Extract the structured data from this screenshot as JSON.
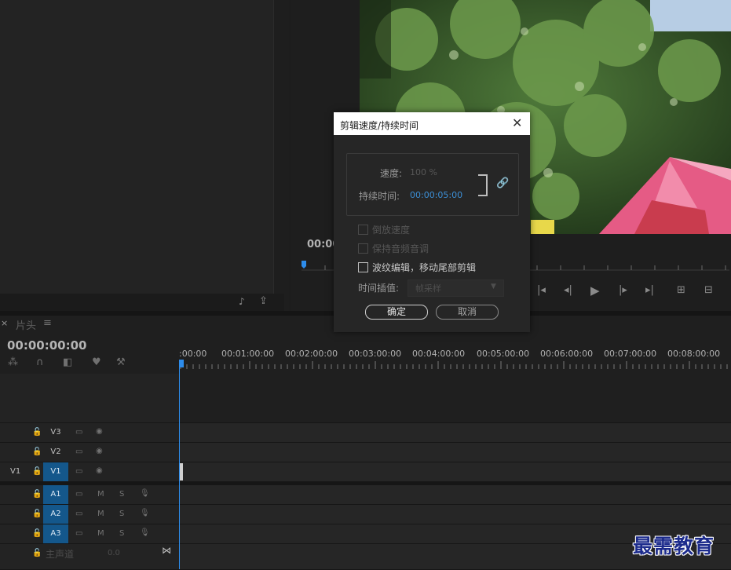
{
  "source_footer_icons": [
    "audio-drag-icon",
    "export-frame-icon"
  ],
  "program": {
    "timecode": "00:00",
    "transport_icons": [
      "step-back-edit-icon",
      "step-back-frame-icon",
      "play-icon",
      "step-forward-frame-icon",
      "step-forward-edit-icon",
      "lift-icon",
      "extract-icon"
    ]
  },
  "timeline": {
    "close_glyph": "×",
    "tab_name": "片头",
    "menu_glyph": "≡",
    "timecode": "00:00:00:00",
    "ruler_labels": [
      ":00:00",
      "00:01:00:00",
      "00:02:00:00",
      "00:03:00:00",
      "00:04:00:00",
      "00:05:00:00",
      "00:06:00:00",
      "00:07:00:00",
      "00:08:00:00"
    ],
    "video_tracks": [
      {
        "name": "V3",
        "source": "",
        "active": false
      },
      {
        "name": "V2",
        "source": "",
        "active": false
      },
      {
        "name": "V1",
        "source": "V1",
        "active": true
      }
    ],
    "audio_tracks": [
      {
        "name": "A1",
        "mute": "M",
        "solo": "S"
      },
      {
        "name": "A2",
        "mute": "M",
        "solo": "S"
      },
      {
        "name": "A3",
        "mute": "M",
        "solo": "S"
      }
    ],
    "master": {
      "label": "主声道",
      "value": "0.0"
    }
  },
  "dialog": {
    "title": "剪辑速度/持续时间",
    "speed_label": "速度:",
    "speed_value": "100 %",
    "duration_label": "持续时间:",
    "duration_value": "00:00:05:00",
    "options": [
      {
        "label": "倒放速度",
        "enabled": false,
        "checked": false
      },
      {
        "label": "保持音频音调",
        "enabled": false,
        "checked": false
      },
      {
        "label": "波纹编辑，移动尾部剪辑",
        "enabled": true,
        "checked": false
      }
    ],
    "interp_label": "时间插值:",
    "interp_value": "帧采样",
    "ok_label": "确定",
    "cancel_label": "取消"
  },
  "watermark": "最需教育",
  "colors": {
    "accent": "#2d8ceb",
    "track_active": "#14578b",
    "roof": "#e8507a"
  }
}
